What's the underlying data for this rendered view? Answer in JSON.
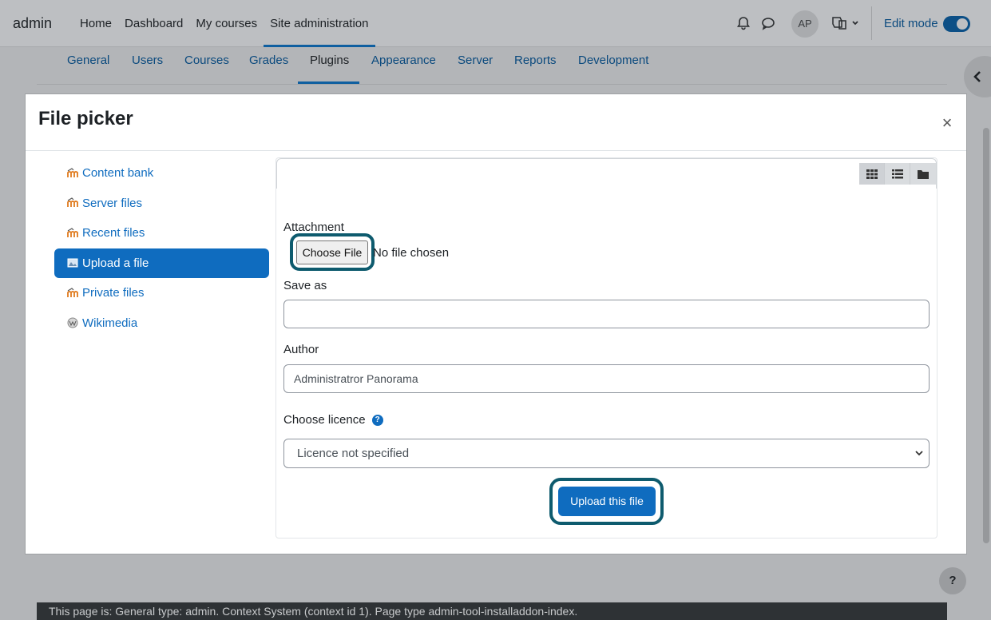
{
  "navbar": {
    "brand": "admin",
    "links": [
      "Home",
      "Dashboard",
      "My courses",
      "Site administration"
    ],
    "active_link": "Site administration",
    "avatar_initials": "AP",
    "edit_mode_label": "Edit mode"
  },
  "subnav": {
    "items": [
      "General",
      "Users",
      "Courses",
      "Grades",
      "Plugins",
      "Appearance",
      "Server",
      "Reports",
      "Development"
    ],
    "active": "Plugins"
  },
  "modal": {
    "title": "File picker",
    "close_label": "×",
    "repositories": [
      {
        "label": "Content bank",
        "icon": "moodle-icon"
      },
      {
        "label": "Server files",
        "icon": "moodle-icon"
      },
      {
        "label": "Recent files",
        "icon": "moodle-icon"
      },
      {
        "label": "Upload a file",
        "icon": "upload-icon",
        "active": true
      },
      {
        "label": "Private files",
        "icon": "moodle-icon"
      },
      {
        "label": "Wikimedia",
        "icon": "wikimedia-icon"
      }
    ],
    "view_modes": [
      "grid-view-icon",
      "list-view-icon",
      "folder-view-icon"
    ],
    "form": {
      "attachment_label": "Attachment",
      "choose_file_label": "Choose File",
      "no_file_text": "No file chosen",
      "save_as_label": "Save as",
      "save_as_value": "",
      "author_label": "Author",
      "author_value": "Administratror Panorama",
      "licence_label": "Choose licence",
      "licence_value": "Licence not specified",
      "upload_label": "Upload this file"
    }
  },
  "help_button": "?",
  "footer_text": "This page is: General type: admin. Context System (context id 1). Page type admin-tool-installaddon-index."
}
